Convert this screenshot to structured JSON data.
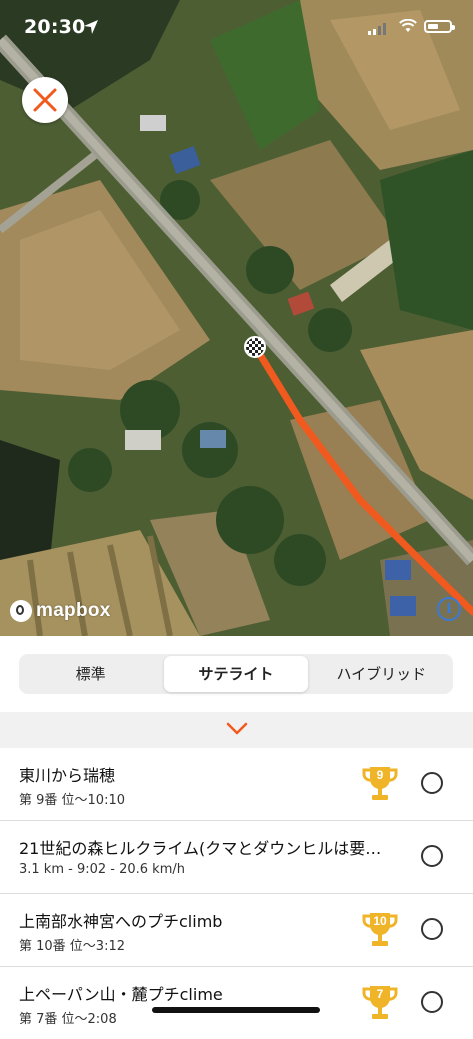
{
  "status_bar": {
    "time": "20:30"
  },
  "map": {
    "attribution": "mapbox",
    "route_color": "#f05a1e"
  },
  "map_type": {
    "options": [
      "標準",
      "サテライト",
      "ハイブリッド"
    ],
    "selected": "サテライト"
  },
  "colors": {
    "trophy": "#f0b429",
    "accent": "#f05a1e"
  },
  "segments": [
    {
      "title": "東川から瑞穂",
      "subtitle": "第 9番 位〜10:10",
      "trophy_rank": "9",
      "has_trophy": true
    },
    {
      "title": "21世紀の森ヒルクライム(クマとダウンヒルは要…",
      "subtitle": "3.1 km - 9:02 - 20.6 km/h",
      "trophy_rank": "",
      "has_trophy": false
    },
    {
      "title": "上南部水神宮へのプチclimb",
      "subtitle": "第 10番 位〜3:12",
      "trophy_rank": "10",
      "has_trophy": true
    },
    {
      "title": "上ペーパン山・麓プチclime",
      "subtitle": "第 7番 位〜2:08",
      "trophy_rank": "7",
      "has_trophy": true
    }
  ]
}
